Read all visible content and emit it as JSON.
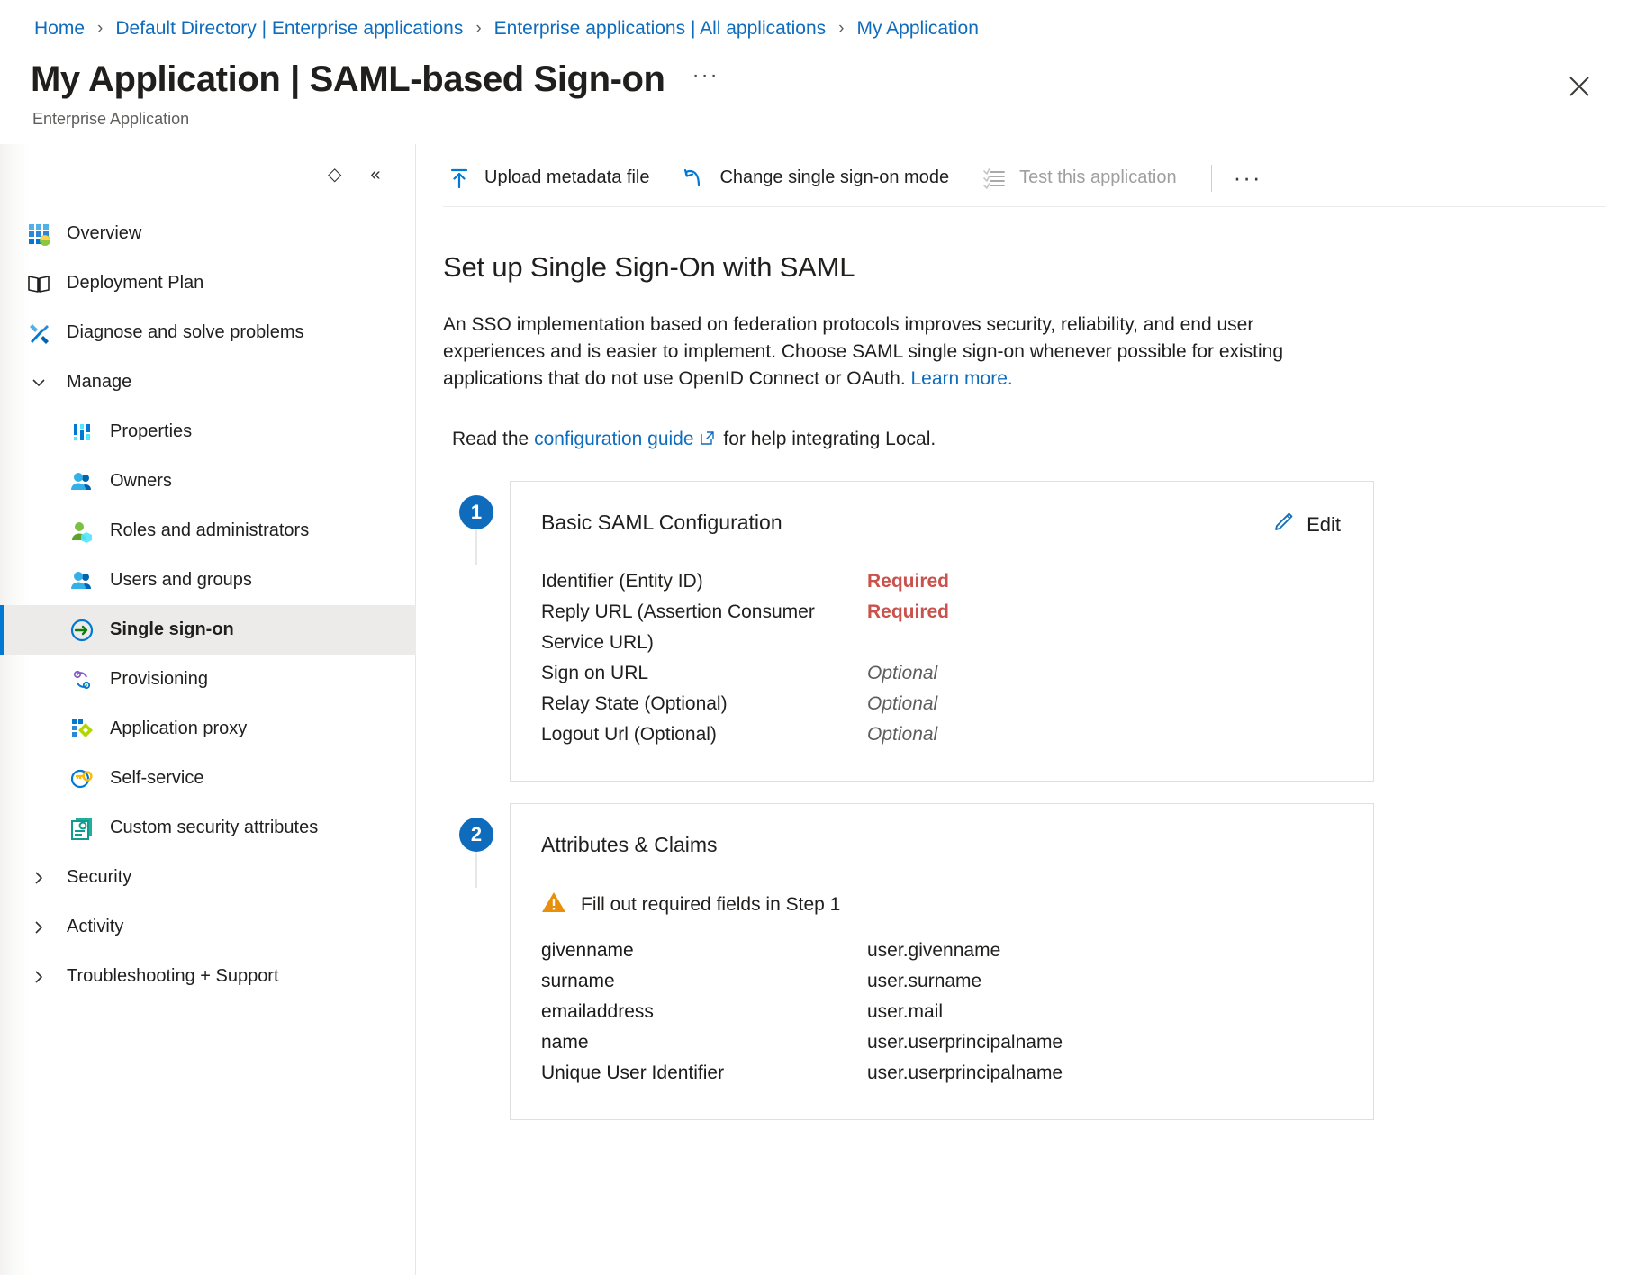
{
  "breadcrumb": [
    {
      "label": "Home"
    },
    {
      "label": "Default Directory | Enterprise applications"
    },
    {
      "label": "Enterprise applications | All applications"
    },
    {
      "label": "My Application"
    }
  ],
  "header": {
    "title": "My Application | SAML-based Sign-on",
    "ellipsis": "···",
    "subtitle": "Enterprise Application",
    "close_icon": "close-icon"
  },
  "rail": {
    "tools": [
      {
        "name": "resize-handle-icon",
        "glyph": "◇"
      },
      {
        "name": "collapse-icon",
        "glyph": "«"
      }
    ],
    "items": [
      {
        "label": "Overview",
        "icon": "overview-icon",
        "type": "item",
        "selected": false
      },
      {
        "label": "Deployment Plan",
        "icon": "deployment-plan-icon",
        "type": "item",
        "selected": false
      },
      {
        "label": "Diagnose and solve problems",
        "icon": "diagnose-icon",
        "type": "item",
        "selected": false
      },
      {
        "label": "Manage",
        "icon": "chevron-down-icon",
        "type": "group-expanded",
        "selected": false
      },
      {
        "label": "Properties",
        "icon": "properties-icon",
        "type": "sub",
        "selected": false
      },
      {
        "label": "Owners",
        "icon": "owners-icon",
        "type": "sub",
        "selected": false
      },
      {
        "label": "Roles and administrators",
        "icon": "roles-icon",
        "type": "sub",
        "selected": false
      },
      {
        "label": "Users and groups",
        "icon": "users-groups-icon",
        "type": "sub",
        "selected": false
      },
      {
        "label": "Single sign-on",
        "icon": "single-sign-on-icon",
        "type": "sub",
        "selected": true
      },
      {
        "label": "Provisioning",
        "icon": "provisioning-icon",
        "type": "sub",
        "selected": false
      },
      {
        "label": "Application proxy",
        "icon": "application-proxy-icon",
        "type": "sub",
        "selected": false
      },
      {
        "label": "Self-service",
        "icon": "self-service-icon",
        "type": "sub",
        "selected": false
      },
      {
        "label": "Custom security attributes",
        "icon": "custom-security-attributes-icon",
        "type": "sub",
        "selected": false
      },
      {
        "label": "Security",
        "icon": "chevron-right-icon",
        "type": "group-collapsed",
        "selected": false
      },
      {
        "label": "Activity",
        "icon": "chevron-right-icon",
        "type": "group-collapsed",
        "selected": false
      },
      {
        "label": "Troubleshooting + Support",
        "icon": "chevron-right-icon",
        "type": "group-collapsed",
        "selected": false
      }
    ]
  },
  "commandbar": {
    "upload_metadata": "Upload metadata file",
    "change_mode": "Change single sign-on mode",
    "test_application": "Test this application",
    "more": "···"
  },
  "main": {
    "heading": "Set up Single Sign-On with SAML",
    "paragraph_part1": "An SSO implementation based on federation protocols improves security, reliability, and end user experiences and is easier to implement. Choose SAML single sign-on whenever possible for existing applications that do not use OpenID Connect or OAuth. ",
    "learn_more": "Learn more.",
    "guide_prefix": "Read the ",
    "guide_link": "configuration guide",
    "guide_suffix": " for help integrating Local."
  },
  "steps": [
    {
      "number": "1",
      "title": "Basic SAML Configuration",
      "edit_label": "Edit",
      "edit_icon": "pencil-icon",
      "rows": [
        {
          "key": "Identifier (Entity ID)",
          "value": "Required",
          "state": "required"
        },
        {
          "key": "Reply URL (Assertion Consumer Service URL)",
          "value": "Required",
          "state": "required"
        },
        {
          "key": "Sign on URL",
          "value": "Optional",
          "state": "optional"
        },
        {
          "key": "Relay State (Optional)",
          "value": "Optional",
          "state": "optional"
        },
        {
          "key": "Logout Url (Optional)",
          "value": "Optional",
          "state": "optional"
        }
      ]
    },
    {
      "number": "2",
      "title": "Attributes & Claims",
      "warning_icon": "warning-icon",
      "warning_text": "Fill out required fields in Step 1",
      "claims": [
        {
          "name": "givenname",
          "value": "user.givenname"
        },
        {
          "name": "surname",
          "value": "user.surname"
        },
        {
          "name": "emailaddress",
          "value": "user.mail"
        },
        {
          "name": "name",
          "value": "user.userprincipalname"
        },
        {
          "name": "Unique User Identifier",
          "value": "user.userprincipalname"
        }
      ]
    }
  ],
  "colors": {
    "link": "#0f6cbd",
    "accent": "#0078d4",
    "required": "#c9534c",
    "optional": "#605e5c",
    "warning": "#e8900c"
  }
}
